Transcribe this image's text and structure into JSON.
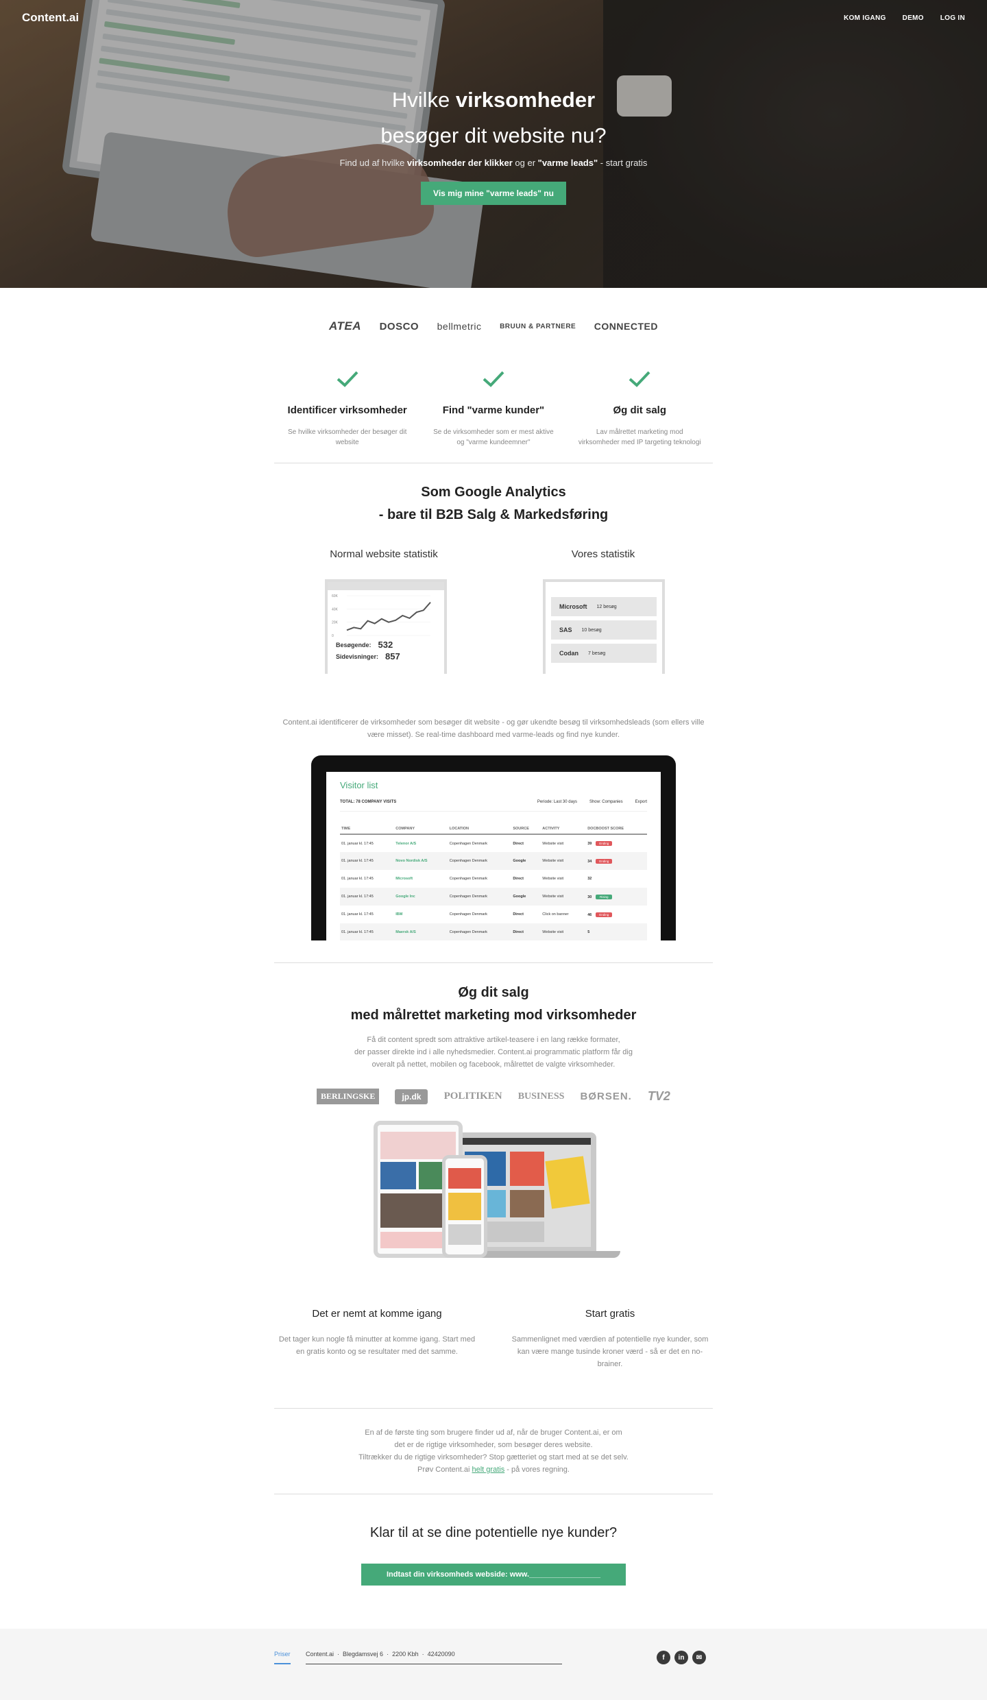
{
  "nav": {
    "logo": "Content.ai",
    "links": [
      "KOM IGANG",
      "DEMO",
      "LOG IN"
    ]
  },
  "hero": {
    "title_part1": "Hvilke ",
    "title_bold": "virksomheder",
    "title_line2": "besøger dit website nu?",
    "sub_part1": "Find ud af hvilke ",
    "sub_bold1": "virksomheder der klikker",
    "sub_part2": " og er ",
    "sub_bold2": "\"varme leads\"",
    "sub_part3": " - start gratis",
    "button": "Vis mig mine \"varme leads\" nu"
  },
  "client_logos": [
    "ATEA",
    "DOSCO",
    "bellmetric",
    "BRUUN & PARTNERE",
    "CONNECTED"
  ],
  "features": [
    {
      "title": "Identificer virksomheder",
      "text": "Se hvilke virksomheder der besøger dit website"
    },
    {
      "title": "Find \"varme kunder\"",
      "text": "Se de virksomheder som er mest aktive og \"varme kundeemner\""
    },
    {
      "title": "Øg dit salg",
      "text": "Lav målrettet marketing mod virksomheder med IP targeting teknologi"
    }
  ],
  "analytics": {
    "title_line1": "Som Google Analytics",
    "title_line2": "- bare til B2B Salg & Markedsføring",
    "left_label": "Normal website statistik",
    "right_label": "Vores statistik",
    "chart_ticks": [
      "60K",
      "40K",
      "20K",
      "0"
    ],
    "chart_data": {
      "type": "line",
      "x": [
        0,
        1,
        2,
        3,
        4,
        5,
        6,
        7,
        8,
        9,
        10,
        11,
        12
      ],
      "values": [
        8,
        12,
        10,
        22,
        18,
        25,
        20,
        23,
        30,
        26,
        35,
        38,
        50
      ],
      "ylim": [
        0,
        60
      ]
    },
    "visitors_label": "Besøgende:",
    "visitors_value": "532",
    "pageviews_label": "Sidevisninger:",
    "pageviews_value": "857",
    "companies": [
      {
        "name": "Microsoft",
        "visits": "12 besøg"
      },
      {
        "name": "SAS",
        "visits": "10 besøg"
      },
      {
        "name": "Codan",
        "visits": "7 besøg"
      }
    ],
    "description": "Content.ai identificerer de virksomheder som besøger dit website - og gør ukendte besøg til virksomhedsleads (som ellers ville være misset). Se real-time dashboard med varme-leads og find nye kunder."
  },
  "dashboard": {
    "title": "Visitor list",
    "total": "TOTAL: 78 COMPANY VISITS",
    "period": "Periode: Last 30 days",
    "show": "Show: Companies",
    "export": "Export",
    "columns": [
      "TIME",
      "COMPANY",
      "LOCATION",
      "SOURCE",
      "ACTIVITY",
      "DOCBOOST SCORE"
    ],
    "rows": [
      {
        "time": "01. januar kl. 17:45",
        "company": "Telenor A/S",
        "location": "Copenhagen Denmark",
        "source": "Direct",
        "activity": "Website visit",
        "score": "39",
        "badge": "Ending",
        "badge_color": "red"
      },
      {
        "time": "01. januar kl. 17:45",
        "company": "Novo Nordisk A/S",
        "location": "Copenhagen Denmark",
        "source": "Google",
        "activity": "Website visit",
        "score": "34",
        "badge": "Ending",
        "badge_color": "red"
      },
      {
        "time": "01. januar kl. 17:45",
        "company": "Microsoft",
        "location": "Copenhagen Denmark",
        "source": "Direct",
        "activity": "Website visit",
        "score": "32",
        "badge": "",
        "badge_color": ""
      },
      {
        "time": "01. januar kl. 17:45",
        "company": "Google Inc",
        "location": "Copenhagen Denmark",
        "source": "Google",
        "activity": "Website visit",
        "score": "30",
        "badge": "Rising",
        "badge_color": "green"
      },
      {
        "time": "01. januar kl. 17:45",
        "company": "IBM",
        "location": "Copenhagen Denmark",
        "source": "Direct",
        "activity": "Click on banner",
        "score": "46",
        "badge": "Ending",
        "badge_color": "red"
      },
      {
        "time": "01. januar kl. 17:45",
        "company": "Maersk A/S",
        "location": "Copenhagen Denmark",
        "source": "Direct",
        "activity": "Website visit",
        "score": "5",
        "badge": "",
        "badge_color": ""
      }
    ]
  },
  "marketing": {
    "title_line1": "Øg dit salg",
    "title_line2": "med målrettet marketing mod virksomheder",
    "text_line1": "Få dit content spredt som attraktive artikel-teasere i en lang række formater,",
    "text_line2": "der passer direkte ind i alle nyhedsmedier. Content.ai programmatic platform får dig",
    "text_line3": "overalt på nettet, mobilen og facebook, målrettet de valgte virksomheder.",
    "media": [
      "BERLINGSKE",
      "jp.dk",
      "POLITIKEN",
      "BUSINESS",
      "BØRSEN.",
      "TV2"
    ]
  },
  "columns": [
    {
      "title": "Det er nemt at komme igang",
      "text": "Det tager kun nogle få minutter at komme igang. Start med en gratis konto og se resultater med det samme."
    },
    {
      "title": "Start gratis",
      "text": "Sammenlignet med værdien af potentielle nye kunder, som kan være mange tusinde kroner værd - så er det en no-brainer."
    }
  ],
  "notice": {
    "line1": "En af de første ting som brugere finder ud af, når de bruger Content.ai, er om",
    "line2": "det er de rigtige virksomheder, som besøger deres website.",
    "line3": "Tiltrækker du de rigtige virksomheder? Stop gætteriet og start med at se det selv.",
    "line4_pre": "Prøv Content.ai ",
    "line4_link": "helt gratis",
    "line4_post": " - på vores regning."
  },
  "cta": {
    "title": "Klar til at se dine potentielle nye kunder?",
    "button": "Indtast din virksomheds webside:  www._________________"
  },
  "footer": {
    "prices": "Priser",
    "info": [
      "Content.ai",
      "·",
      "Blegdamsvej 6",
      "·",
      "2200 Kbh",
      "·",
      "42420090"
    ],
    "social": [
      "facebook-icon",
      "linkedin-icon",
      "mail-icon"
    ]
  },
  "colors": {
    "accent": "#45a979",
    "badge_red": "#e0575b"
  }
}
